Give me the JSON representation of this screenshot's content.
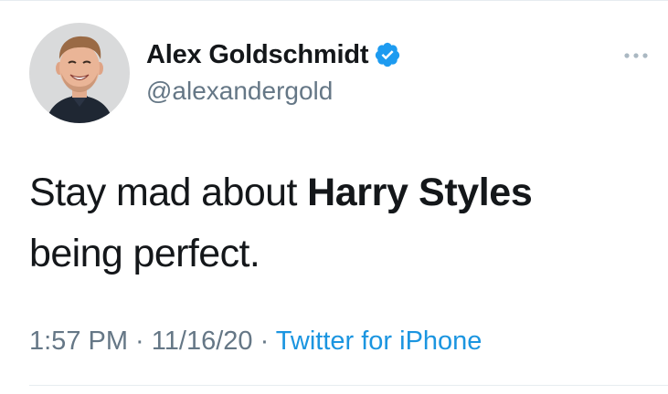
{
  "author": {
    "display_name": "Alex Goldschmidt",
    "handle": "@alexandergold",
    "verified": true,
    "verified_icon": "verified-badge-icon",
    "avatar_icon": "profile-photo"
  },
  "tweet": {
    "text_before": "Stay mad about ",
    "text_bold": "Harry Styles",
    "text_after_line1": "",
    "text_line2": "being perfect."
  },
  "meta": {
    "time": "1:57 PM",
    "separator1": " · ",
    "date": "11/16/20",
    "separator2": " · ",
    "source": "Twitter for iPhone"
  },
  "menu": {
    "icon": "more-options-icon"
  },
  "colors": {
    "text_primary": "#14171a",
    "text_secondary": "#657786",
    "link": "#1b95e0",
    "verified": "#1d9bf0"
  }
}
